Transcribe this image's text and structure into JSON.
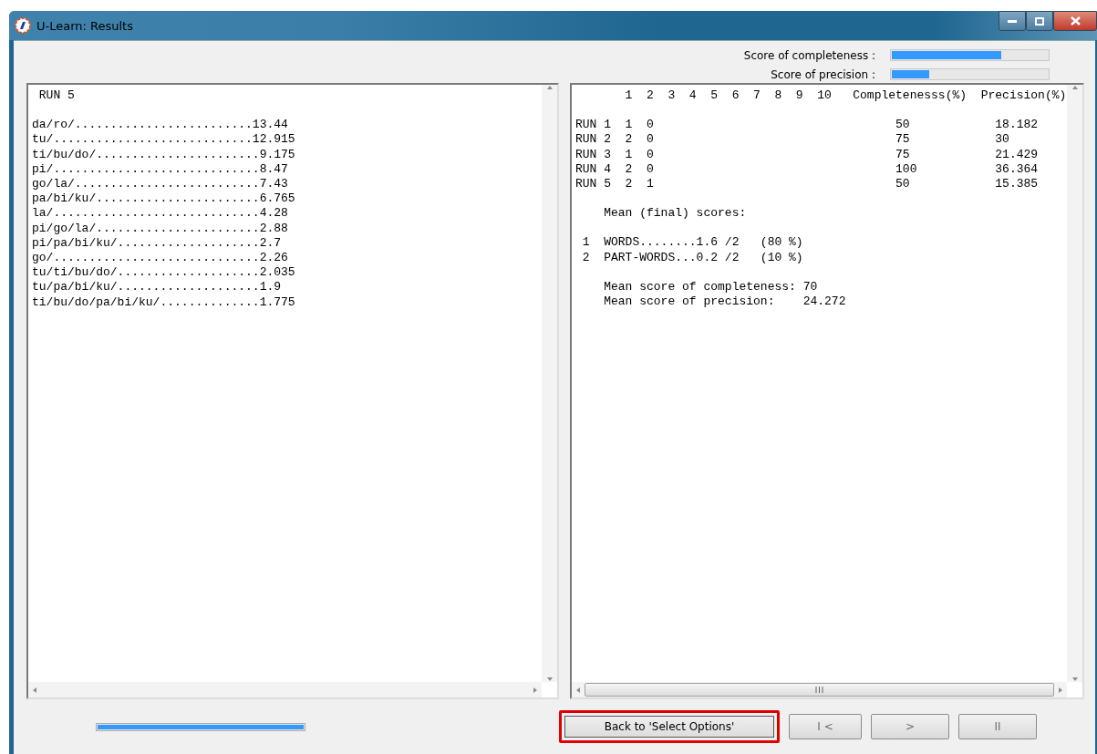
{
  "window": {
    "title": "U-Learn: Results"
  },
  "scores": [
    {
      "label": "Score of completeness :",
      "level": 0.7
    },
    {
      "label": "Score of precision :",
      "level": 0.24
    }
  ],
  "left_pane": {
    "blocks": [
      [
        " RUN 5"
      ],
      [
        "da/ro/.........................13.44",
        "tu/............................12.915",
        "ti/bu/do/.......................9.175",
        "pi/.............................8.47",
        "go/la/..........................7.43",
        "pa/bi/ku/.......................6.765",
        "la/.............................4.28",
        "pi/go/la/.......................2.88",
        "pi/pa/bi/ku/....................2.7",
        "go/.............................2.26",
        "tu/ti/bu/do/....................2.035",
        "tu/pa/bi/ku/....................1.9",
        "ti/bu/do/pa/bi/ku/..............1.775"
      ]
    ]
  },
  "right_pane": {
    "blocks": [
      [
        "       1  2  3  4  5  6  7  8  9  10   Completenesss(%)  Precision(%)"
      ],
      [
        "RUN 1  1  0                                  50            18.182",
        "RUN 2  2  0                                  75            30",
        "RUN 3  1  0                                  75            21.429",
        "RUN 4  2  0                                  100           36.364",
        "RUN 5  2  1                                  50            15.385"
      ],
      [
        "    Mean (final) scores:"
      ],
      [
        " 1  WORDS........1.6 /2   (80 %)",
        " 2  PART-WORDS...0.2 /2   (10 %)"
      ],
      [
        "    Mean score of completeness: 70",
        "    Mean score of precision:    24.272"
      ]
    ]
  },
  "progress": {
    "level": 1
  },
  "buttons": [
    {
      "label": "Back to 'Select Options'",
      "disabled": false,
      "highlighted": true
    },
    {
      "label": "I <",
      "disabled": true,
      "highlighted": false
    },
    {
      "label": ">",
      "disabled": true,
      "highlighted": false
    },
    {
      "label": "II",
      "disabled": true,
      "highlighted": false
    }
  ]
}
